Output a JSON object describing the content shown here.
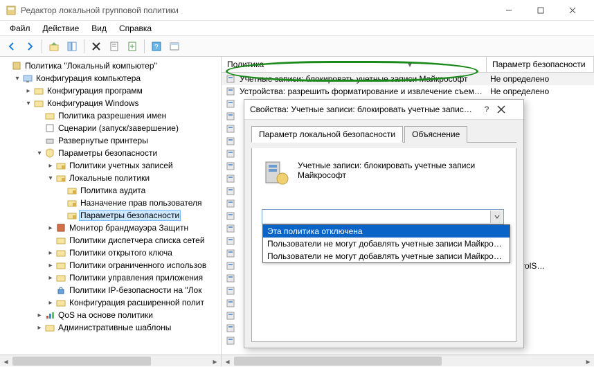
{
  "title": "Редактор локальной групповой политики",
  "menu": {
    "file": "Файл",
    "action": "Действие",
    "view": "Вид",
    "help": "Справка"
  },
  "tree": {
    "root": "Политика \"Локальный компьютер\"",
    "comp_config": "Конфигурация компьютера",
    "software": "Конфигурация программ",
    "windows": "Конфигурация Windows",
    "name_policy": "Политика разрешения имен",
    "scripts": "Сценарии (запуск/завершение)",
    "printers": "Развернутые принтеры",
    "security": "Параметры безопасности",
    "account_policies": "Политики учетных записей",
    "local_policies": "Локальные политики",
    "audit_policy": "Политика аудита",
    "user_rights": "Назначение прав пользователя",
    "sec_options": "Параметры безопасности",
    "firewall": "Монитор брандмауэра Защитн",
    "netlist": "Политики диспетчера списка сетей",
    "pubkey": "Политики открытого ключа",
    "restricted": "Политики ограниченного использов",
    "appctrl": "Политики управления приложения",
    "ipsec": "Политики IP-безопасности на \"Лок",
    "advaudit": "Конфигурация расширенной полит",
    "qos": "QoS на основе политики",
    "admin_templates": "Административные шаблоны"
  },
  "columns": {
    "policy": "Политика",
    "security_param": "Параметр безопасности"
  },
  "rows": [
    {
      "text": "Учетные записи: блокировать учетные записи Майкрософт",
      "sec": "Не определено"
    },
    {
      "text": "Устройства: разрешить форматирование и извлечение съем…",
      "sec": "Не определено"
    },
    {
      "text": "",
      "sec": "ено"
    },
    {
      "text": "",
      "sec": ""
    },
    {
      "text": "",
      "sec": ""
    },
    {
      "text": "",
      "sec": ""
    },
    {
      "text": "",
      "sec": ""
    },
    {
      "text": "",
      "sec": ""
    },
    {
      "text": "",
      "sec": ""
    },
    {
      "text": "",
      "sec": "ено"
    },
    {
      "text": "",
      "sec": ""
    },
    {
      "text": "",
      "sec": ""
    },
    {
      "text": "",
      "sec": "ено"
    },
    {
      "text": "",
      "sec": "ено"
    },
    {
      "text": "",
      "sec": "ено"
    },
    {
      "text": "",
      "sec": "rentControlS…"
    },
    {
      "text": "",
      "sec": ""
    },
    {
      "text": "",
      "sec": ""
    },
    {
      "text": "",
      "sec": "ено"
    },
    {
      "text": "",
      "sec": ""
    },
    {
      "text": "",
      "sec": "ено"
    },
    {
      "text": "",
      "sec": ""
    }
  ],
  "dialog": {
    "title": "Свойства: Учетные записи: блокировать учетные запис…",
    "tab_local": "Параметр локальной безопасности",
    "tab_explain": "Объяснение",
    "policy_name": "Учетные записи: блокировать учетные записи Майкрософт",
    "dropdown": {
      "options": [
        "Эта политика отключена",
        "Пользователи не могут добавлять учетные записи Майкрософт",
        "Пользователи не могут добавлять учетные записи Майкрософт и исп"
      ],
      "selected_index": 0
    }
  }
}
